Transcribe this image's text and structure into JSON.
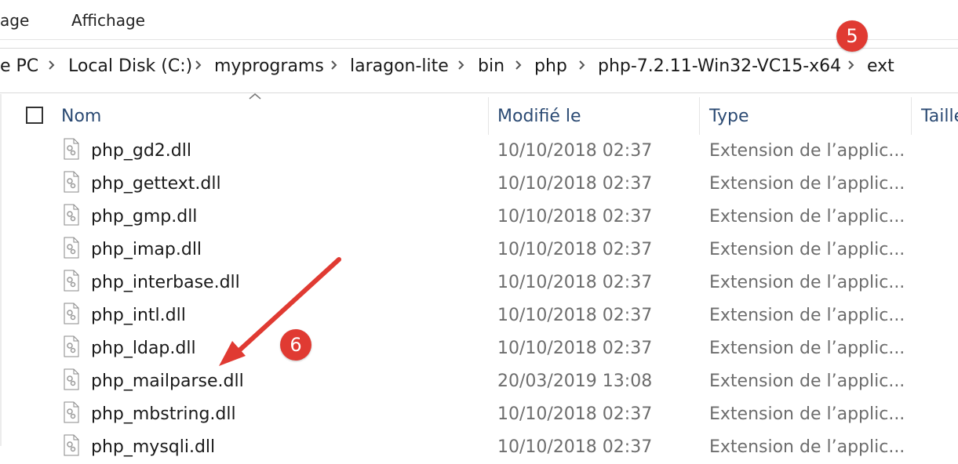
{
  "menu": {
    "item_left": "age",
    "item_view": "Affichage"
  },
  "breadcrumb": [
    "e PC",
    "Local Disk (C:)",
    "myprograms",
    "laragon-lite",
    "bin",
    "php",
    "php-7.2.11-Win32-VC15-x64",
    "ext"
  ],
  "columns": {
    "name": "Nom",
    "modified": "Modifié le",
    "type": "Type",
    "size": "Taille"
  },
  "files": [
    {
      "name": "php_gd2.dll",
      "modified": "10/10/2018 02:37",
      "type": "Extension de l’applic..."
    },
    {
      "name": "php_gettext.dll",
      "modified": "10/10/2018 02:37",
      "type": "Extension de l’applic..."
    },
    {
      "name": "php_gmp.dll",
      "modified": "10/10/2018 02:37",
      "type": "Extension de l’applic..."
    },
    {
      "name": "php_imap.dll",
      "modified": "10/10/2018 02:37",
      "type": "Extension de l’applic..."
    },
    {
      "name": "php_interbase.dll",
      "modified": "10/10/2018 02:37",
      "type": "Extension de l’applic..."
    },
    {
      "name": "php_intl.dll",
      "modified": "10/10/2018 02:37",
      "type": "Extension de l’applic..."
    },
    {
      "name": "php_ldap.dll",
      "modified": "10/10/2018 02:37",
      "type": "Extension de l’applic..."
    },
    {
      "name": "php_mailparse.dll",
      "modified": "20/03/2019 13:08",
      "type": "Extension de l’applic..."
    },
    {
      "name": "php_mbstring.dll",
      "modified": "10/10/2018 02:37",
      "type": "Extension de l’applic..."
    },
    {
      "name": "php_mysqli.dll",
      "modified": "10/10/2018 02:37",
      "type": "Extension de l’applic..."
    }
  ],
  "annotations": {
    "step5": "5",
    "step6": "6",
    "color": "#e03a32"
  }
}
